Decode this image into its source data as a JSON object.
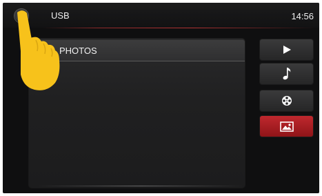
{
  "header": {
    "title": "USB",
    "time": "14:56",
    "home_icon": "home-icon"
  },
  "list": {
    "items": [
      {
        "label": "PHOTOS"
      }
    ]
  },
  "sidebar": {
    "buttons": [
      {
        "icon": "play-icon",
        "active": false
      },
      {
        "icon": "music-note-icon",
        "active": false
      },
      {
        "icon": "film-reel-icon",
        "active": false
      },
      {
        "icon": "photo-icon",
        "active": true
      }
    ]
  },
  "colors": {
    "accent": "#b3202a",
    "background": "#0f0f10",
    "finger": "#f7c21b"
  }
}
